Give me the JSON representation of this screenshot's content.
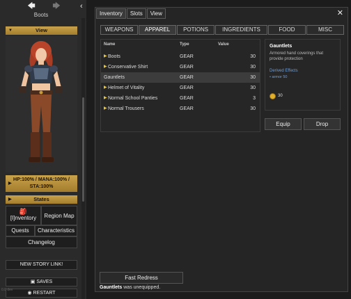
{
  "sidebar": {
    "back_arrow": "🡄",
    "forward_arrow": "🡆",
    "collapse": "‹",
    "location": "Boots",
    "view_label": "View",
    "stats": "HP:100% / MANA:100% / STA:100%",
    "states_label": "States",
    "inventory_label": "[I]nventory",
    "region_map_label": "Region Map",
    "quests_label": "Quests",
    "characteristics_label": "Characteristics",
    "changelog_label": "Changelog",
    "new_story_label": "NEW STORY LINK!",
    "saves_label": "SAVES",
    "restart_label": "RESTART",
    "version": "0.0 dev"
  },
  "window": {
    "tabs": [
      "Inventory",
      "Slots",
      "View"
    ],
    "close": "✕"
  },
  "categories": [
    "WEAPONS",
    "APPAREL",
    "POTIONS",
    "INGREDIENTS",
    "FOOD",
    "MISC"
  ],
  "list": {
    "headers": {
      "name": "Name",
      "type": "Type",
      "value": "Value"
    },
    "rows": [
      {
        "name": "Boots",
        "type": "GEAR",
        "value": "30"
      },
      {
        "name": "Conservative Shirt",
        "type": "GEAR",
        "value": "30"
      },
      {
        "name": "Gauntlets",
        "type": "GEAR",
        "value": "30"
      },
      {
        "name": "Helmet of Vitality",
        "type": "GEAR",
        "value": "30"
      },
      {
        "name": "Normal School Panties",
        "type": "GEAR",
        "value": "3"
      },
      {
        "name": "Normal Trousers",
        "type": "GEAR",
        "value": "30"
      }
    ]
  },
  "detail": {
    "name": "Gauntlets",
    "description": "Armored hand coverings that provide protection",
    "effects_title": "Derived Effects",
    "effect": "armor 50",
    "price": "30",
    "equip_label": "Equip",
    "drop_label": "Drop"
  },
  "footer": {
    "redress_label": "Fast Redress",
    "status_item": "Gauntlets",
    "status_text": " was unequipped."
  },
  "colors": {
    "accent_gold": "#c9a24c",
    "list_arrow": "#e6c640",
    "effect_blue": "#6f9fd8"
  }
}
